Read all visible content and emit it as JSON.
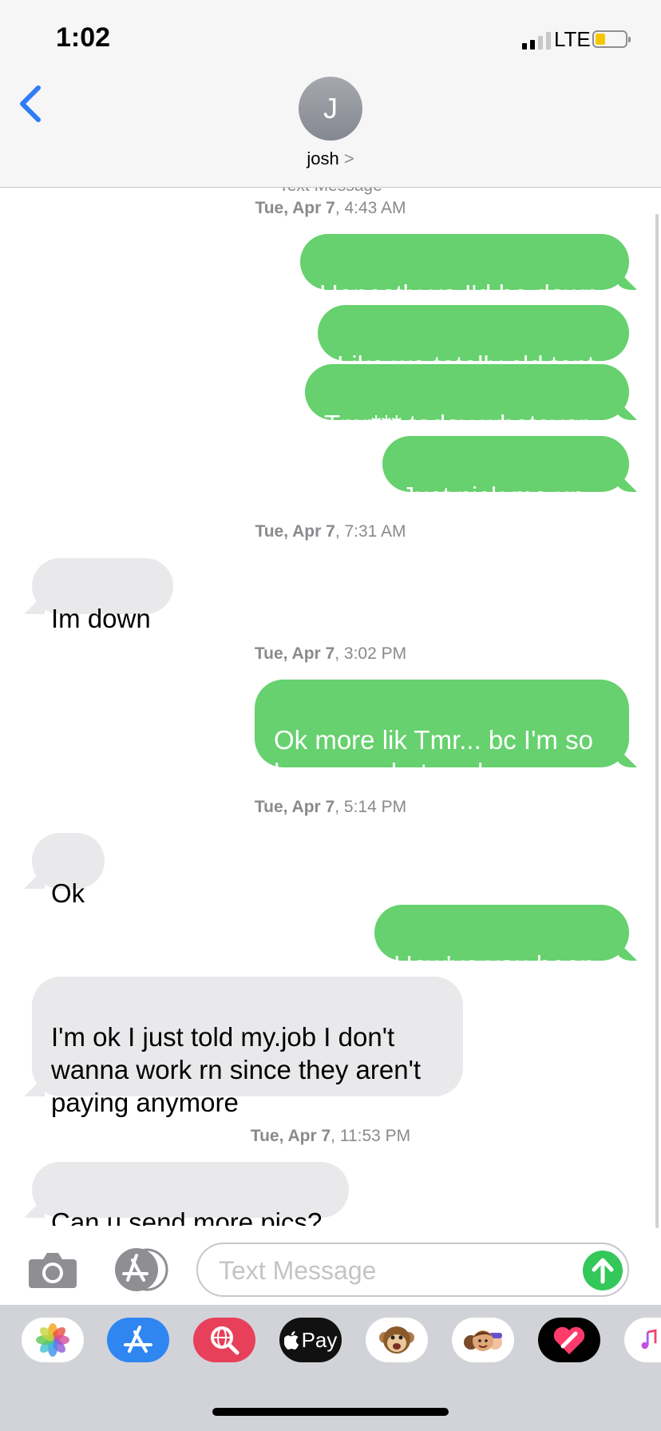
{
  "status_bar": {
    "time": "1:02",
    "network": "LTE"
  },
  "header": {
    "contact_initial": "J",
    "contact_name": "josh",
    "contact_chevron": ">"
  },
  "thread": {
    "top_label": "Text Message",
    "timestamps": [
      {
        "day": "Tue, Apr 7",
        "time": ", 4:43 AM"
      },
      {
        "day": "Tue, Apr 7",
        "time": ", 7:31 AM"
      },
      {
        "day": "Tue, Apr 7",
        "time": ", 3:02 PM"
      },
      {
        "day": "Tue, Apr 7",
        "time": ", 5:14 PM"
      },
      {
        "day": "Tue, Apr 7",
        "time": ", 11:53 PM"
      }
    ],
    "messages": [
      {
        "text": "Honestly ya I'd be down"
      },
      {
        "text": "Like we totally cld tent"
      },
      {
        "text": "Tmr*** today whatever"
      },
      {
        "text": "Just pick me up.."
      },
      {
        "text": "Im down"
      },
      {
        "text": "Ok more lik Tmr... bc I'm so\nhungover but cool"
      },
      {
        "text": "Ok"
      },
      {
        "text": "How've you been"
      },
      {
        "text": "I'm ok I just told my.job I don't\nwanna work rn since they aren't\npaying anymore"
      },
      {
        "text_before": "Can u send more ",
        "text_link": "pics",
        "text_after": "?"
      }
    ]
  },
  "composer": {
    "placeholder": "Text Message"
  },
  "drawer": {
    "apple_pay_label": "Pay"
  },
  "colors": {
    "sent_bubble": "#66d16e",
    "received_bubble": "#e9e9eb",
    "send_button": "#34c759",
    "accent": "#2f7cf6"
  },
  "icons": [
    "back-chevron-icon",
    "camera-icon",
    "app-store-icon",
    "send-arrow-icon",
    "photos-icon",
    "web-search-icon",
    "apple-pay-icon",
    "animoji-icon",
    "memoji-icon",
    "digital-touch-icon",
    "music-icon"
  ]
}
